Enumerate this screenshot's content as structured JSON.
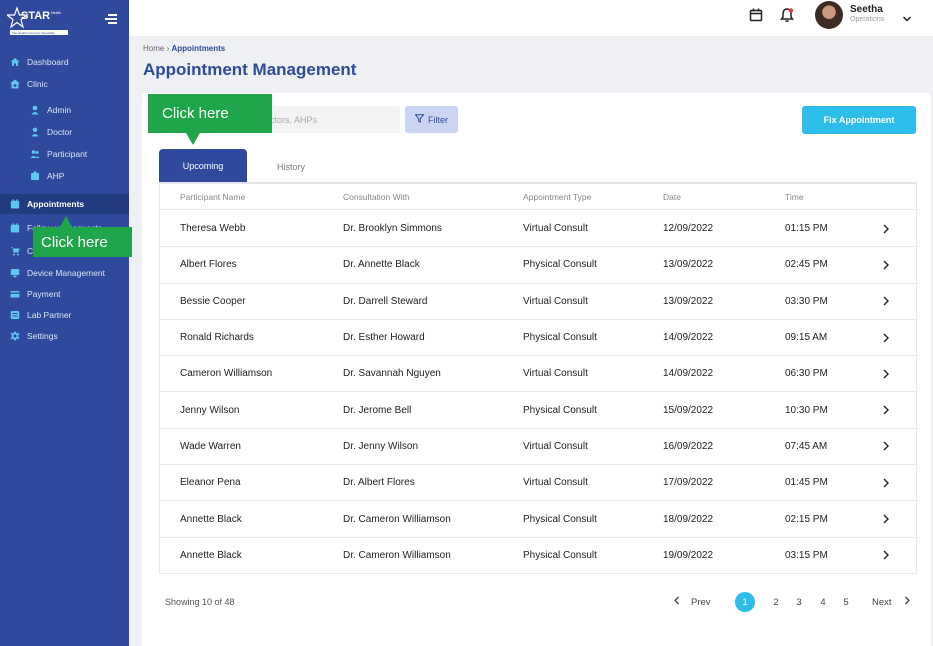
{
  "brand": {
    "logo_text": "STAR",
    "logo_sub": "Health",
    "tagline": "The Health Insurance Specialist"
  },
  "sidebar": {
    "items": [
      {
        "label": "Dashboard",
        "icon": "home-icon"
      },
      {
        "label": "Clinic",
        "icon": "clinic-icon"
      },
      {
        "label": "Admin",
        "icon": "admin-icon"
      },
      {
        "label": "Doctor",
        "icon": "doctor-icon"
      },
      {
        "label": "Participant",
        "icon": "participant-icon"
      },
      {
        "label": "AHP",
        "icon": "ahp-icon"
      },
      {
        "label": "Appointments",
        "icon": "calendar-icon"
      },
      {
        "label": "Follow-up Requests",
        "icon": "calendar-icon"
      },
      {
        "label": "C",
        "icon": "cart-icon"
      },
      {
        "label": "Device Management",
        "icon": "device-icon"
      },
      {
        "label": "Payment",
        "icon": "payment-icon"
      },
      {
        "label": "Lab Partner",
        "icon": "lab-icon"
      },
      {
        "label": "Settings",
        "icon": "gear-icon"
      }
    ]
  },
  "topbar": {
    "user_name": "Seetha",
    "user_role": "Operations"
  },
  "breadcrumb": {
    "home": "Home",
    "sep": "›",
    "current": "Appointments"
  },
  "page_title": "Appointment Management",
  "search": {
    "placeholder": "ctors, AHPs"
  },
  "filter_label": "Filter",
  "fix_button": "Fix Appointment",
  "tabs": [
    {
      "label": "Upcoming"
    },
    {
      "label": "History"
    }
  ],
  "table": {
    "headers": [
      "Participant Name",
      "Consultation With",
      "Appointment Type",
      "Date",
      "Time"
    ],
    "rows": [
      [
        "Theresa Webb",
        "Dr. Brooklyn Simmons",
        "Virtual Consult",
        "12/09/2022",
        "01:15 PM"
      ],
      [
        "Albert Flores",
        "Dr. Annette Black",
        "Physical Consult",
        "13/09/2022",
        "02:45 PM"
      ],
      [
        "Bessie Cooper",
        "Dr. Darrell Steward",
        "Virtual Consult",
        "13/09/2022",
        "03:30 PM"
      ],
      [
        "Ronald Richards",
        "Dr. Esther Howard",
        "Physical Consult",
        "14/09/2022",
        "09:15 AM"
      ],
      [
        "Cameron Williamson",
        "Dr. Savannah Nguyen",
        "Virtual Consult",
        "14/09/2022",
        "06:30 PM"
      ],
      [
        "Jenny Wilson",
        "Dr. Jerome Bell",
        "Physical Consult",
        "15/09/2022",
        "10:30 PM"
      ],
      [
        "Wade Warren",
        "Dr. Jenny Wilson",
        "Virtual Consult",
        "16/09/2022",
        "07:45 AM"
      ],
      [
        "Eleanor Pena",
        "Dr. Albert Flores",
        "Virtual Consult",
        "17/09/2022",
        "01:45 PM"
      ],
      [
        "Annette Black",
        "Dr. Cameron Williamson",
        "Physical Consult",
        "18/09/2022",
        "02:15 PM"
      ],
      [
        "Annette Black",
        "Dr. Cameron Williamson",
        "Physical Consult",
        "19/09/2022",
        "03:15 PM"
      ]
    ]
  },
  "pagination": {
    "showing": "Showing 10 of 48",
    "prev": "Prev",
    "next": "Next",
    "pages": [
      "1",
      "2",
      "3",
      "4",
      "5"
    ],
    "current": "1"
  },
  "callouts": {
    "tab_hint": "Click here",
    "sidebar_hint": "Click here"
  },
  "colors": {
    "sidebar": "#2f4a9c",
    "accent": "#2cbde8",
    "callout": "#1fa64a"
  }
}
